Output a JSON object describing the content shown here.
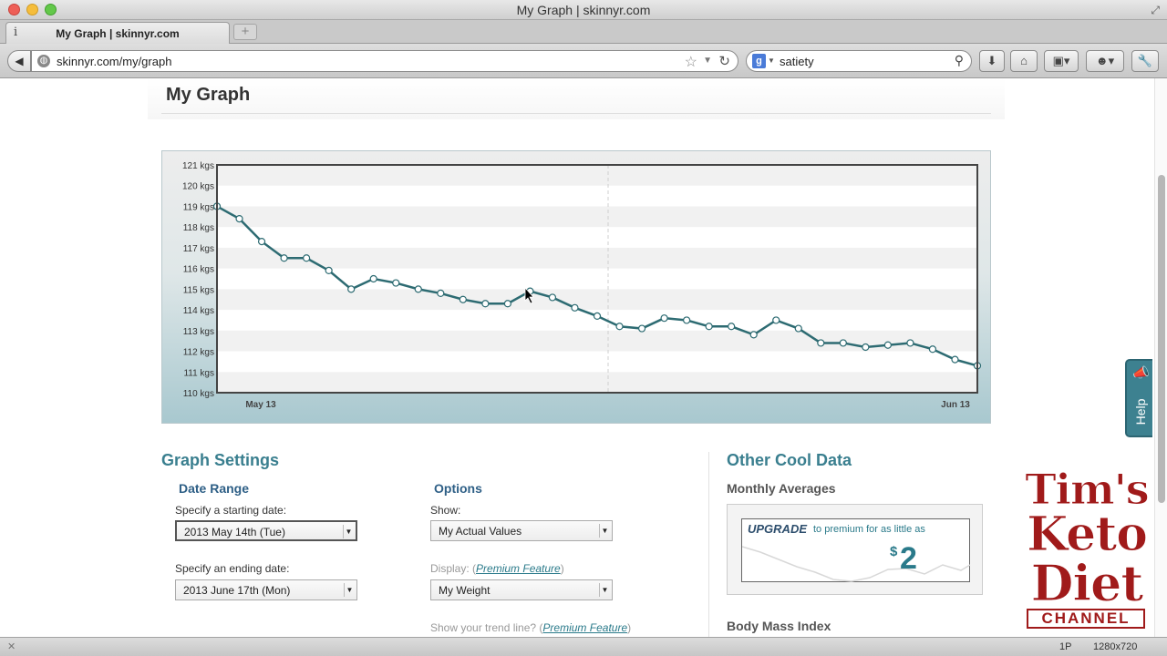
{
  "window": {
    "title": "My Graph | skinnyr.com",
    "tab_label": "My Graph | skinnyr.com",
    "new_tab_label": "+"
  },
  "navbar": {
    "url": "skinnyr.com/my/graph",
    "search_query": "satiety",
    "search_engine_icon": "g"
  },
  "page": {
    "title": "My Graph"
  },
  "chart_data": {
    "type": "line",
    "title": "",
    "xlabel": "",
    "ylabel": "",
    "unit": "kgs",
    "y_ticks": [
      "121 kgs",
      "120 kgs",
      "119 kgs",
      "118 kgs",
      "117 kgs",
      "116 kgs",
      "115 kgs",
      "114 kgs",
      "113 kgs",
      "112 kgs",
      "111 kgs",
      "110 kgs"
    ],
    "x_tick_labels": [
      "May 13",
      "Jun 13"
    ],
    "ylim": [
      110,
      121
    ],
    "grid": true,
    "series": [
      {
        "name": "",
        "values": [
          119.0,
          118.4,
          117.3,
          116.5,
          116.5,
          115.9,
          115.0,
          115.5,
          115.3,
          115.0,
          114.8,
          114.5,
          114.3,
          114.3,
          114.9,
          114.6,
          114.1,
          113.7,
          113.2,
          113.1,
          113.6,
          113.5,
          113.2,
          113.2,
          112.8,
          113.5,
          113.1,
          112.4,
          112.4,
          112.2,
          112.3,
          112.4,
          112.1,
          111.6,
          111.3
        ]
      }
    ]
  },
  "settings": {
    "heading": "Graph Settings",
    "date_range": {
      "heading": "Date Range",
      "start_label": "Specify a starting date:",
      "start_value": "2013 May 14th (Tue)",
      "end_label": "Specify an ending date:",
      "end_value": "2013 June 17th (Mon)"
    },
    "options": {
      "heading": "Options",
      "show_label": "Show:",
      "show_value": "My Actual Values",
      "display_label": "Display:",
      "display_link": "Premium Feature",
      "display_value": "My Weight",
      "trend_label": "Show your trend line?",
      "trend_link": "Premium Feature"
    }
  },
  "other": {
    "heading": "Other Cool Data",
    "monthly_heading": "Monthly Averages",
    "upgrade_word": "UPGRADE",
    "upgrade_rest": "to premium for as little as",
    "upgrade_dollar": "$",
    "upgrade_price": "2",
    "bmi_heading": "Body Mass Index"
  },
  "help": {
    "label": "Help"
  },
  "brand": {
    "line1": "Tim's",
    "line2": "Keto",
    "line3": "Diet",
    "line4": "CHANNEL"
  },
  "statusbar": {
    "left": "✕",
    "page_indicator": "1P",
    "resolution": "1280x720"
  },
  "colors": {
    "accent": "#3a7f8f",
    "line": "#2d6b72",
    "brand_red": "#a01a1a"
  }
}
